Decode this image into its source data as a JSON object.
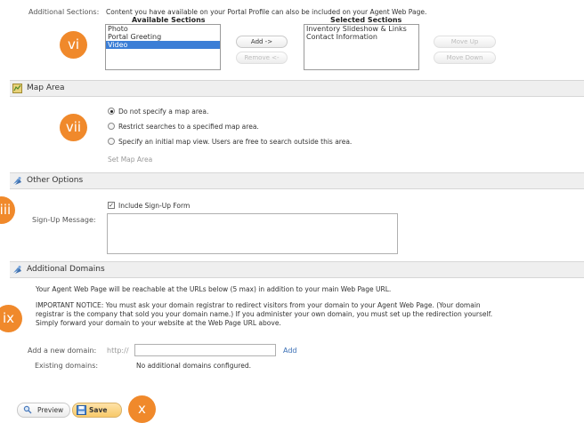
{
  "sections": {
    "label": "Additional Sections:",
    "description": "Content you have available on your Portal Profile can also be included on your Agent Web Page.",
    "available_header": "Available Sections",
    "selected_header": "Selected Sections",
    "available_items": [
      "Photo",
      "Portal Greeting",
      "Video"
    ],
    "selected_items": [
      "Inventory Slideshow & Links",
      "Contact Information"
    ],
    "add_label": "Add ->",
    "remove_label": "Remove <-",
    "move_up_label": "Move Up",
    "move_down_label": "Move Down"
  },
  "map": {
    "title": "Map Area",
    "options": [
      "Do not specify a map area.",
      "Restrict searches to a specified map area.",
      "Specify an initial map view. Users are free to search outside this area."
    ],
    "set_link": "Set Map Area"
  },
  "other": {
    "title": "Other Options",
    "checkbox_label": "Include Sign-Up Form",
    "signup_label": "Sign-Up Message:"
  },
  "domains": {
    "title": "Additional Domains",
    "intro": "Your Agent Web Page will be reachable at the URLs below (5 max) in addition to your main Web Page URL.",
    "notice_1": "IMPORTANT NOTICE: You must ask your domain registrar to redirect visitors from your domain to your Agent Web Page. (Your domain",
    "notice_2": "registrar is the company that sold you your domain name.) If you administer your own domain, you must set up the redirection yourself.",
    "notice_3": "Simply forward your domain to your website at the Web Page URL above.",
    "add_label": "Add a new domain:",
    "prefix": "http://",
    "add_link": "Add",
    "existing_label": "Existing domains:",
    "existing_value": "No additional domains configured."
  },
  "footer": {
    "preview_label": "Preview",
    "save_label": "Save"
  },
  "badges": [
    "vi",
    "vii",
    "viii",
    "ix",
    "x"
  ],
  "colors": {
    "badge": "#f0892b",
    "selected": "#3b7ed6",
    "link": "#3a6fb5",
    "section_bar": "#efefef"
  }
}
